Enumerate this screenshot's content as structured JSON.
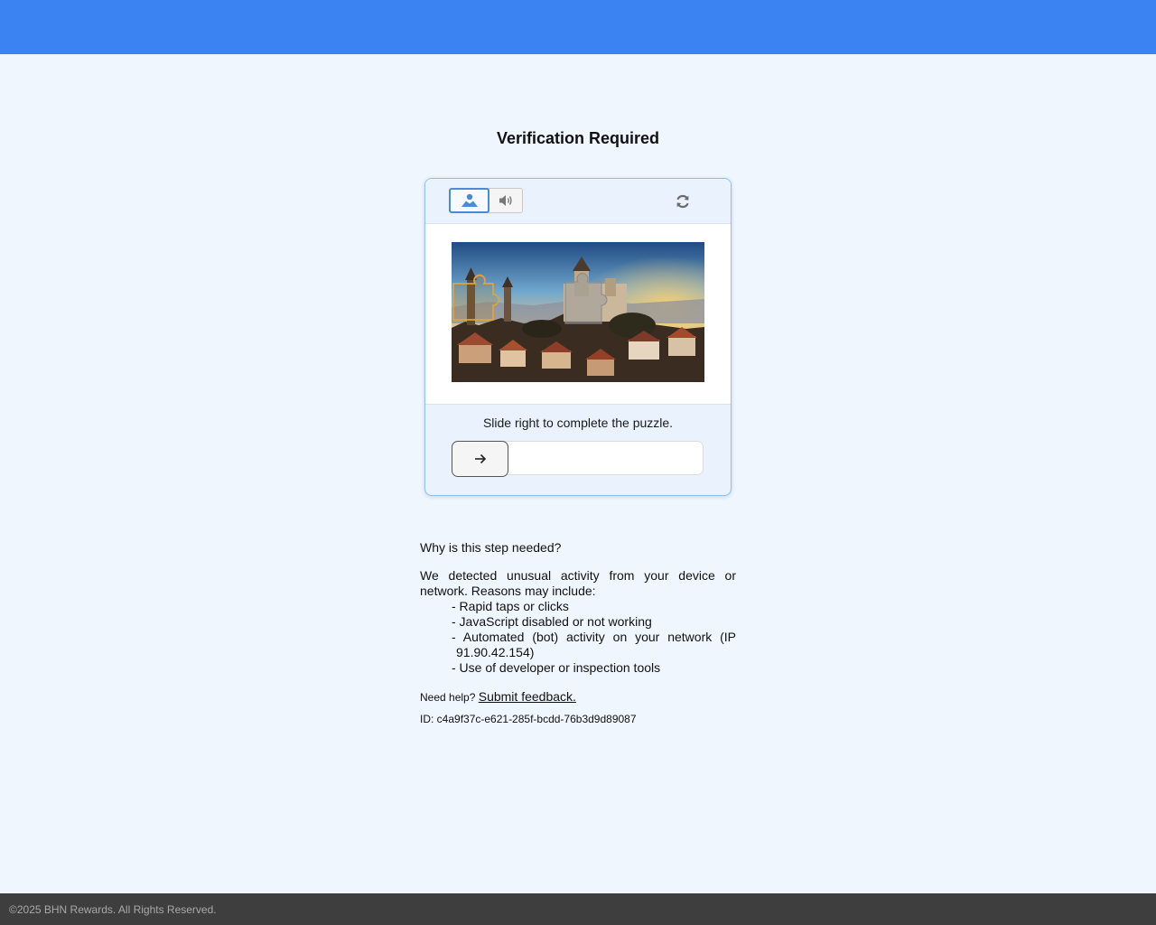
{
  "header": {
    "bar_color": "#3b83f2"
  },
  "page": {
    "title": "Verification Required"
  },
  "captcha": {
    "modes": {
      "image_icon": "image-mode-icon",
      "audio_icon": "speaker-icon",
      "selected": "image"
    },
    "refresh_icon": "refresh-icon",
    "instruction": "Slide right to complete the puzzle.",
    "slider": {
      "handle_icon": "arrow-right-icon",
      "progress": 0
    }
  },
  "info": {
    "heading": "Why is this step needed?",
    "paragraph": "We detected unusual activity from your device or network. Reasons may include:",
    "reasons": [
      "- Rapid taps or clicks",
      "- JavaScript disabled or not working",
      "- Automated (bot) activity on your network (IP 91.90.42.154)",
      "- Use of developer or inspection tools"
    ],
    "help_prefix": "Need help?",
    "help_link": "Submit feedback.",
    "request_id": "ID: c4a9f37c-e621-285f-bcdd-76b3d9d89087"
  },
  "footer": {
    "copyright": "©2025 BHN Rewards. All Rights Reserved."
  }
}
